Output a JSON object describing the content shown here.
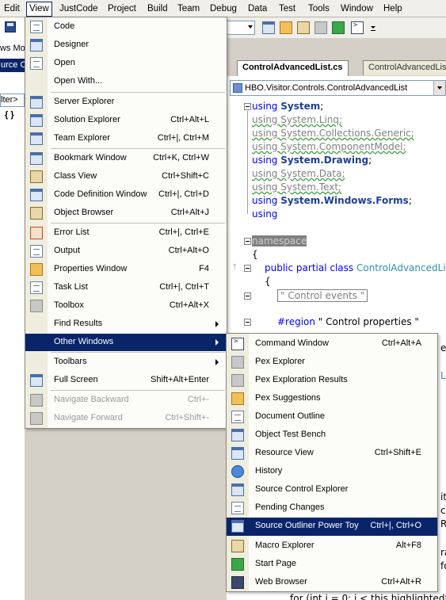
{
  "menubar": {
    "items": [
      "Edit",
      "View",
      "JustCode",
      "Project",
      "Build",
      "Team",
      "Debug",
      "Data",
      "Test",
      "Tools",
      "Window",
      "Help"
    ],
    "active": "View"
  },
  "left_panel": {
    "line1": "ws Mo",
    "line2": "urce O",
    "filter": "lter>",
    "braces": "{ }"
  },
  "editor": {
    "tabs": [
      "ControlAdvancedList.cs",
      "ControlAdvancedList"
    ],
    "nav_combo": "HBO.Visitor.Controls.ControlAdvancedList",
    "code_lines": {
      "using1_kw": "using",
      "using1_ns": "System",
      "using1_end": ";",
      "using2": "using System.Linq;",
      "using3": "using System.Collections.Generic;",
      "using4": "using System.ComponentModel;",
      "using5_kw": "using",
      "using5_ns": "System.Drawing",
      "using5_end": ";",
      "using6": "using System.Data;",
      "using7": "using System.Text;",
      "using8_kw": "using",
      "using8_ns": "System.Windows.Forms",
      "using8_end": ";",
      "using9": "using",
      "namespace": "namespace",
      "brace_open": "{",
      "class_kw": "public partial class",
      "class_name": "ControlAdvancedList",
      "brace_open2": "{",
      "region1": "\" Control events \"",
      "region2_kw": "#region",
      "region2_name": "\" Control properties \""
    },
    "code_fragments": {
      "f1": "et",
      "f2": "Li",
      "f3": "it",
      "f4": "ce",
      "f5": "R",
      "f6": "ra",
      "f7": "fo",
      "bottom": "for (int i = 0; i < this.highlightedIte"
    }
  },
  "view_menu": {
    "items": [
      {
        "label": "Code",
        "shortcut": "",
        "icon": "code-icon"
      },
      {
        "label": "Designer",
        "shortcut": "",
        "icon": "designer-icon"
      },
      {
        "label": "Open",
        "shortcut": "",
        "icon": "open-icon"
      },
      {
        "label": "Open With...",
        "shortcut": "",
        "icon": ""
      },
      {
        "label": "Server Explorer",
        "shortcut": "",
        "icon": "server-explorer-icon"
      },
      {
        "label": "Solution Explorer",
        "shortcut": "Ctrl+Alt+L",
        "icon": "solution-explorer-icon"
      },
      {
        "label": "Team Explorer",
        "shortcut": "Ctrl+|, Ctrl+M",
        "icon": "team-explorer-icon"
      },
      {
        "label": "Bookmark Window",
        "shortcut": "Ctrl+K, Ctrl+W",
        "icon": "bookmark-window-icon"
      },
      {
        "label": "Class View",
        "shortcut": "Ctrl+Shift+C",
        "icon": "class-view-icon"
      },
      {
        "label": "Code Definition Window",
        "shortcut": "Ctrl+|, Ctrl+D",
        "icon": "code-definition-icon"
      },
      {
        "label": "Object Browser",
        "shortcut": "Ctrl+Alt+J",
        "icon": "object-browser-icon"
      },
      {
        "label": "Error List",
        "shortcut": "Ctrl+|, Ctrl+E",
        "icon": "error-list-icon"
      },
      {
        "label": "Output",
        "shortcut": "Ctrl+Alt+O",
        "icon": "output-icon"
      },
      {
        "label": "Properties Window",
        "shortcut": "F4",
        "icon": "properties-icon"
      },
      {
        "label": "Task List",
        "shortcut": "Ctrl+|, Ctrl+T",
        "icon": "task-list-icon"
      },
      {
        "label": "Toolbox",
        "shortcut": "Ctrl+Alt+X",
        "icon": "toolbox-icon"
      },
      {
        "label": "Find Results",
        "shortcut": "",
        "icon": ""
      },
      {
        "label": "Other Windows",
        "shortcut": "",
        "icon": ""
      },
      {
        "label": "Toolbars",
        "shortcut": "",
        "icon": ""
      },
      {
        "label": "Full Screen",
        "shortcut": "Shift+Alt+Enter",
        "icon": "full-screen-icon"
      },
      {
        "label": "Navigate Backward",
        "shortcut": "Ctrl+-",
        "icon": "navigate-backward-icon"
      },
      {
        "label": "Navigate Forward",
        "shortcut": "Ctrl+Shift+-",
        "icon": "navigate-forward-icon"
      }
    ]
  },
  "other_windows_menu": {
    "items": [
      {
        "label": "Command Window",
        "shortcut": "Ctrl+Alt+A",
        "icon": "command-window-icon"
      },
      {
        "label": "Pex Explorer",
        "shortcut": "",
        "icon": "pex-explorer-icon"
      },
      {
        "label": "Pex Exploration Results",
        "shortcut": "",
        "icon": "pex-results-icon"
      },
      {
        "label": "Pex Suggestions",
        "shortcut": "",
        "icon": "pex-suggestions-icon"
      },
      {
        "label": "Document Outline",
        "shortcut": "",
        "icon": "document-outline-icon"
      },
      {
        "label": "Object Test Bench",
        "shortcut": "",
        "icon": "object-test-bench-icon"
      },
      {
        "label": "Resource View",
        "shortcut": "Ctrl+Shift+E",
        "icon": "resource-view-icon"
      },
      {
        "label": "History",
        "shortcut": "",
        "icon": "history-icon"
      },
      {
        "label": "Source Control Explorer",
        "shortcut": "",
        "icon": "source-control-icon"
      },
      {
        "label": "Pending Changes",
        "shortcut": "",
        "icon": "pending-changes-icon"
      },
      {
        "label": "Source Outliner Power Toy",
        "shortcut": "Ctrl+|, Ctrl+O",
        "icon": "source-outliner-icon"
      },
      {
        "label": "Macro Explorer",
        "shortcut": "Alt+F8",
        "icon": "macro-explorer-icon"
      },
      {
        "label": "Start Page",
        "shortcut": "",
        "icon": "start-page-icon"
      },
      {
        "label": "Web Browser",
        "shortcut": "Ctrl+Alt+R",
        "icon": "web-browser-icon"
      }
    ]
  },
  "colors": {
    "highlight": "#0a246a",
    "keyword": "#0000ff",
    "type": "#2b91af",
    "menu_gutter": "#efedde"
  }
}
